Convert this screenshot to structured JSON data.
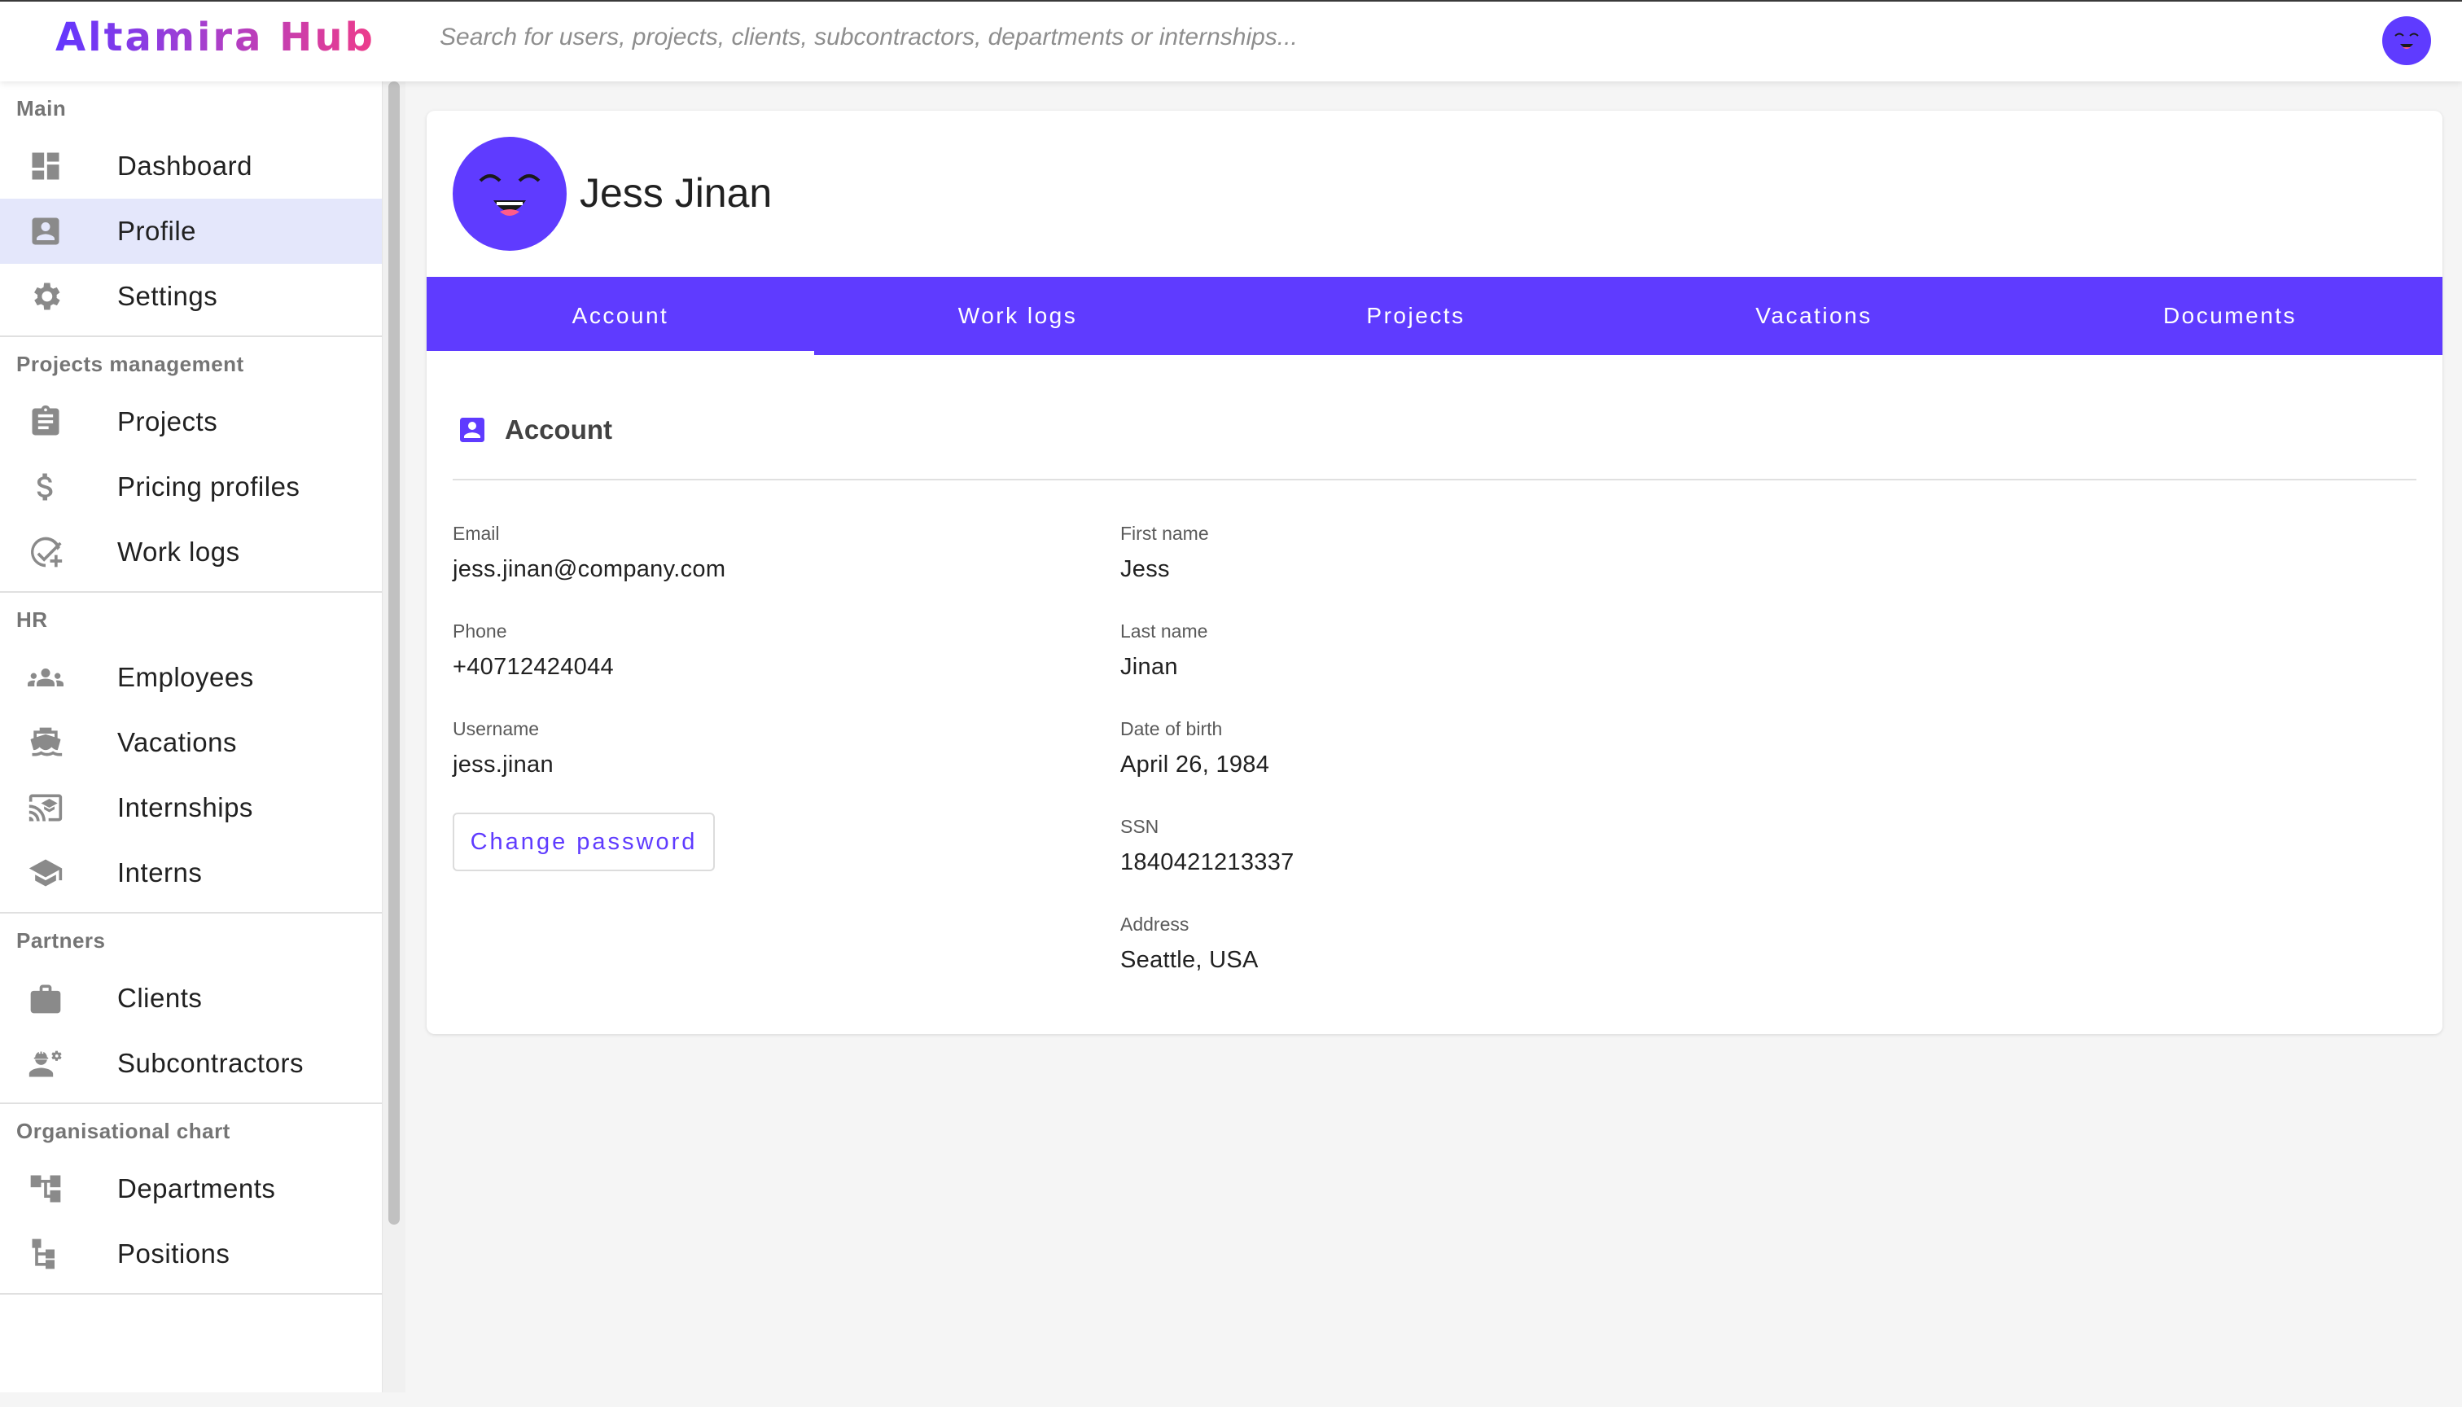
{
  "app": {
    "logo": "Altamira Hub"
  },
  "search": {
    "placeholder": "Search for users, projects, clients, subcontractors, departments or internships..."
  },
  "sidebar": {
    "sections": [
      {
        "title": "Main",
        "items": [
          {
            "label": "Dashboard",
            "icon": "dashboard-icon"
          },
          {
            "label": "Profile",
            "icon": "profile-icon",
            "active": true
          },
          {
            "label": "Settings",
            "icon": "gear-icon"
          }
        ]
      },
      {
        "title": "Projects management",
        "items": [
          {
            "label": "Projects",
            "icon": "clipboard-icon"
          },
          {
            "label": "Pricing profiles",
            "icon": "dollar-icon"
          },
          {
            "label": "Work logs",
            "icon": "check-plus-icon"
          }
        ]
      },
      {
        "title": "HR",
        "items": [
          {
            "label": "Employees",
            "icon": "people-icon"
          },
          {
            "label": "Vacations",
            "icon": "beach-icon"
          },
          {
            "label": "Internships",
            "icon": "cast-education-icon"
          },
          {
            "label": "Interns",
            "icon": "graduation-cap-icon"
          }
        ]
      },
      {
        "title": "Partners",
        "items": [
          {
            "label": "Clients",
            "icon": "briefcase-icon"
          },
          {
            "label": "Subcontractors",
            "icon": "engineer-icon"
          }
        ]
      },
      {
        "title": "Organisational chart",
        "items": [
          {
            "label": "Departments",
            "icon": "tree-icon"
          },
          {
            "label": "Positions",
            "icon": "hierarchy-icon"
          }
        ]
      }
    ]
  },
  "profile": {
    "name": "Jess Jinan",
    "tabs": [
      {
        "label": "Account",
        "active": true
      },
      {
        "label": "Work logs"
      },
      {
        "label": "Projects"
      },
      {
        "label": "Vacations"
      },
      {
        "label": "Documents"
      }
    ],
    "section_title": "Account",
    "left_fields": [
      {
        "label": "Email",
        "value": "jess.jinan@company.com"
      },
      {
        "label": "Phone",
        "value": "+40712424044"
      },
      {
        "label": "Username",
        "value": "jess.jinan"
      }
    ],
    "right_fields": [
      {
        "label": "First name",
        "value": "Jess"
      },
      {
        "label": "Last name",
        "value": "Jinan"
      },
      {
        "label": "Date of birth",
        "value": "April 26, 1984"
      },
      {
        "label": "SSN",
        "value": "1840421213337"
      },
      {
        "label": "Address",
        "value": "Seattle, USA"
      }
    ],
    "change_password_label": "Change password"
  },
  "colors": {
    "accent": "#5f3bff",
    "active_nav_bg": "#e4e7fb",
    "avatar": "#5f3bff"
  }
}
